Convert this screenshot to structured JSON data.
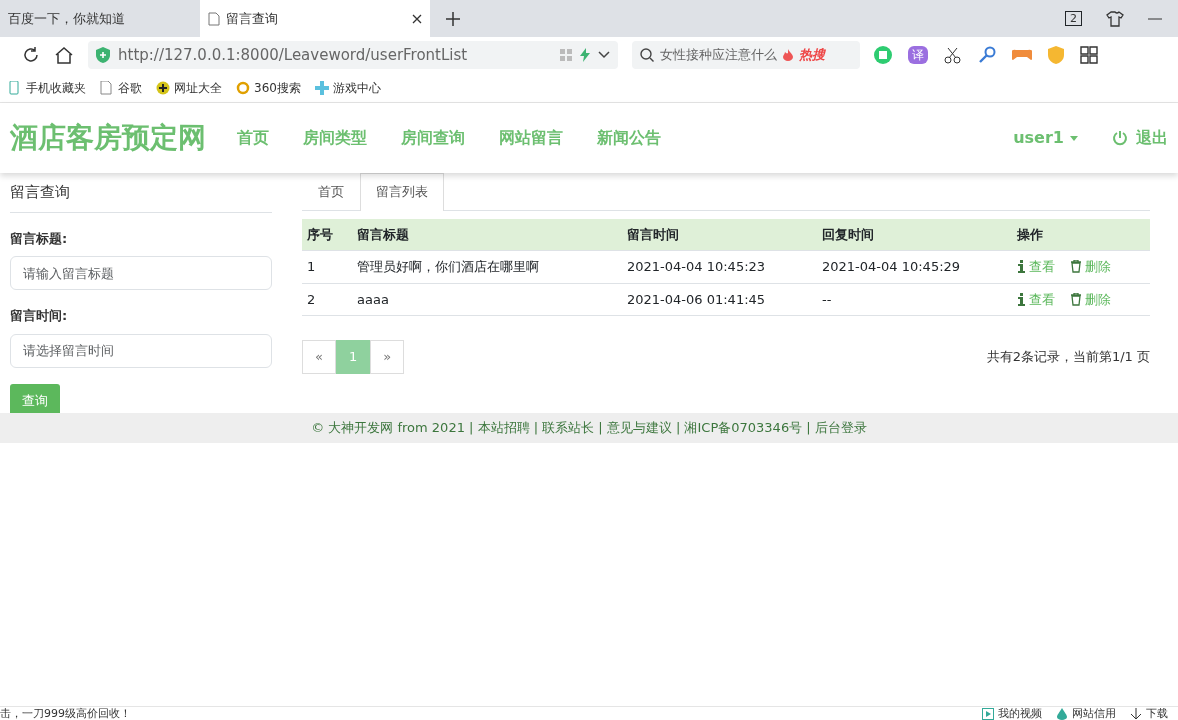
{
  "browser": {
    "tabs": [
      {
        "title": "百度一下，你就知道",
        "selected": false
      },
      {
        "title": "留言查询",
        "selected": true
      }
    ],
    "tab_count": "2",
    "address": {
      "url": "http://127.0.0.1:8000/Leaveword/userFrontList"
    },
    "search": {
      "placeholder": "女性接种应注意什么",
      "badge": "热搜"
    },
    "translate_label": "译",
    "bookmarks": [
      {
        "label": "手机收藏夹",
        "kind": "phone"
      },
      {
        "label": "谷歌",
        "kind": "page"
      },
      {
        "label": "网址大全",
        "kind": "plus"
      },
      {
        "label": "360搜索",
        "kind": "ring"
      },
      {
        "label": "游戏中心",
        "kind": "cross"
      }
    ]
  },
  "site": {
    "brand": "酒店客房预定网",
    "nav": [
      "首页",
      "房间类型",
      "房间查询",
      "网站留言",
      "新闻公告"
    ],
    "user": "user1",
    "logout": "退出"
  },
  "sidebar": {
    "title": "留言查询",
    "fields": [
      {
        "label": "留言标题:",
        "placeholder": "请输入留言标题"
      },
      {
        "label": "留言时间:",
        "placeholder": "请选择留言时间"
      }
    ],
    "button": "查询"
  },
  "content_tabs": [
    {
      "label": "首页",
      "selected": false
    },
    {
      "label": "留言列表",
      "selected": true
    }
  ],
  "table": {
    "columns": [
      "序号",
      "留言标题",
      "留言时间",
      "回复时间",
      "操作"
    ],
    "rows": [
      {
        "cells": [
          "1",
          "管理员好啊，你们酒店在哪里啊",
          "2021-04-04 10:45:23",
          "2021-04-04 10:45:29"
        ],
        "actions": [
          {
            "kind": "view",
            "label": "查看"
          },
          {
            "kind": "delete",
            "label": "删除"
          }
        ]
      },
      {
        "cells": [
          "2",
          "aaaa",
          "2021-04-06 01:41:45",
          "--"
        ],
        "actions": [
          {
            "kind": "view",
            "label": "查看"
          },
          {
            "kind": "delete",
            "label": "删除"
          }
        ]
      }
    ]
  },
  "pagination": {
    "prev": "«",
    "pages": [
      {
        "label": "1",
        "selected": true
      }
    ],
    "next": "»"
  },
  "summary": "共有2条记录，当前第1/1 页",
  "footer": "© 大神开发网 from 2021 | 本站招聘 | 联系站长 | 意见与建议 | 湘ICP备0703346号 | 后台登录",
  "status_bar": {
    "message": "击，一刀999级高价回收！",
    "items": [
      {
        "kind": "video",
        "label": "我的视频"
      },
      {
        "kind": "drop",
        "label": "网站信用"
      },
      {
        "kind": "download",
        "label": "下载"
      }
    ]
  }
}
